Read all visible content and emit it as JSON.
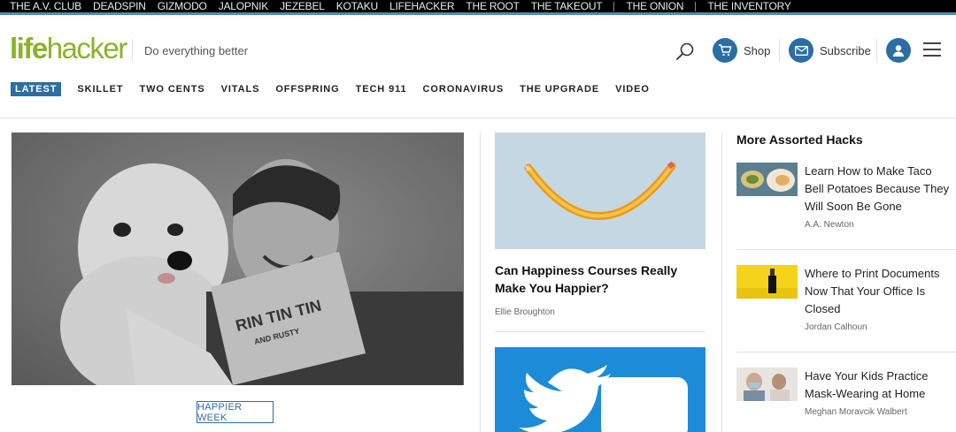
{
  "network": {
    "links": [
      "THE A.V. CLUB",
      "DEADSPIN",
      "GIZMODO",
      "JALOPNIK",
      "JEZEBEL",
      "KOTAKU",
      "LIFEHACKER",
      "THE ROOT",
      "THE TAKEOUT"
    ],
    "links_after": [
      "THE ONION",
      "THE INVENTORY"
    ]
  },
  "header": {
    "logo_part1": "life",
    "logo_part2": "hacker",
    "tagline": "Do everything better",
    "shop_label": "Shop",
    "subscribe_label": "Subscribe"
  },
  "nav": {
    "items": [
      "LATEST",
      "SKILLET",
      "TWO CENTS",
      "VITALS",
      "OFFSPRING",
      "TECH 911",
      "CORONAVIRUS",
      "THE UPGRADE",
      "VIDEO"
    ],
    "active": "LATEST"
  },
  "hero": {
    "image_alt": "Boy reading a Rin Tin Tin book with a dog",
    "book_title": "RIN TIN TIN",
    "book_subtitle": "AND RUSTY",
    "tag": "HAPPIER WEEK"
  },
  "feature": {
    "title": "Can Happiness Courses Really Make You Happier?",
    "author": "Ellie Broughton"
  },
  "sidebar": {
    "title": "More Assorted Hacks",
    "items": [
      {
        "title": "Learn How to Make Taco Bell Potatoes Because They Will Soon Be Gone",
        "author": "A.A. Newton"
      },
      {
        "title": "Where to Print Documents Now That Your Office Is Closed",
        "author": "Jordan Calhoun"
      },
      {
        "title": "Have Your Kids Practice Mask-Wearing at Home",
        "author": "Meghan Moravcik Walbert"
      }
    ]
  },
  "colors": {
    "brand_green": "#8bb22b",
    "accent_blue": "#2c6ea3",
    "network_bar": "#000000"
  }
}
